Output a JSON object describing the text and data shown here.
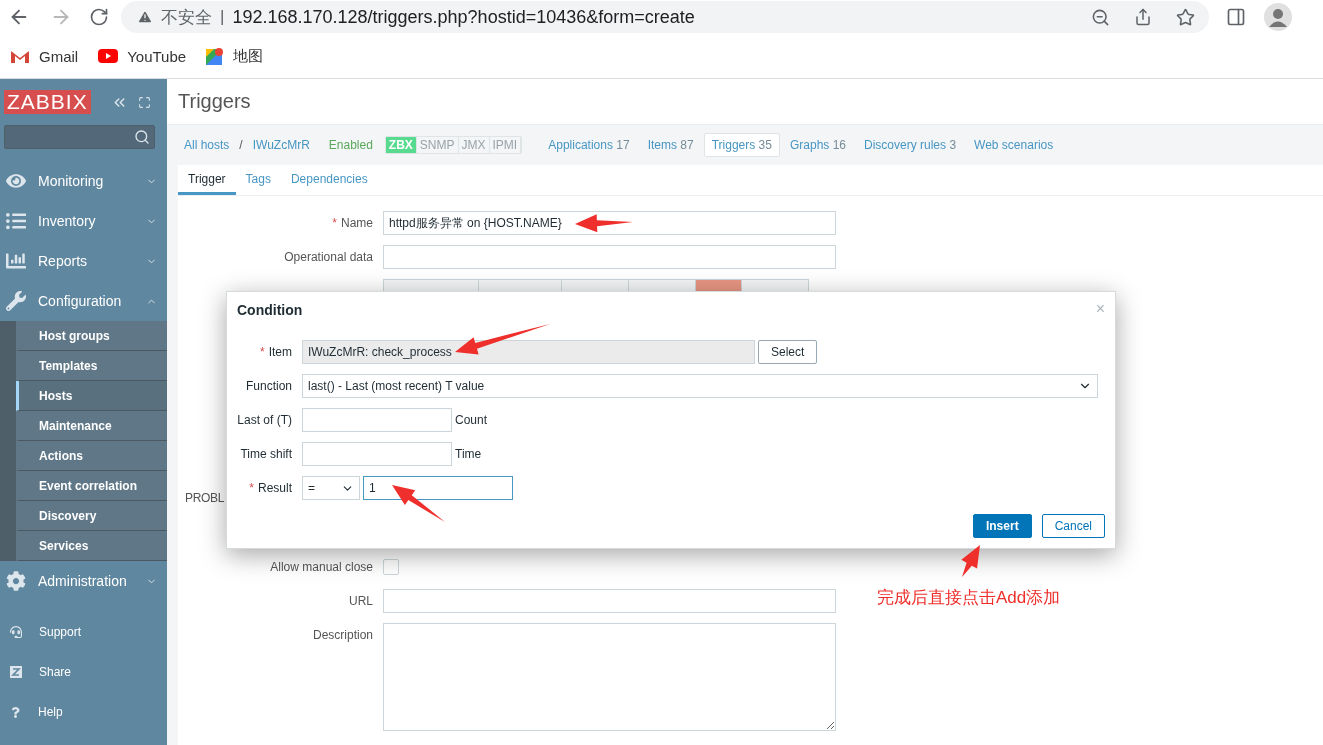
{
  "browser": {
    "security": "不安全",
    "separator": "|",
    "url": "192.168.170.128/triggers.php?hostid=10436&form=create",
    "bookmarks": [
      {
        "label": "Gmail"
      },
      {
        "label": "YouTube"
      },
      {
        "label": "地图"
      }
    ]
  },
  "sidebar": {
    "logo": "ZABBIX",
    "menu": [
      {
        "label": "Monitoring",
        "expanded": false
      },
      {
        "label": "Inventory",
        "expanded": false
      },
      {
        "label": "Reports",
        "expanded": false
      },
      {
        "label": "Configuration",
        "expanded": true,
        "children": [
          {
            "label": "Host groups",
            "selected": false
          },
          {
            "label": "Templates",
            "selected": false
          },
          {
            "label": "Hosts",
            "selected": true
          },
          {
            "label": "Maintenance",
            "selected": false
          },
          {
            "label": "Actions",
            "selected": false
          },
          {
            "label": "Event correlation",
            "selected": false
          },
          {
            "label": "Discovery",
            "selected": false
          },
          {
            "label": "Services",
            "selected": false
          }
        ]
      },
      {
        "label": "Administration",
        "expanded": false
      }
    ],
    "links": [
      {
        "label": "Support"
      },
      {
        "label": "Share"
      },
      {
        "label": "Help"
      }
    ]
  },
  "header": {
    "title": "Triggers"
  },
  "host_nav": {
    "breadcrumbs": [
      "All hosts",
      "IWuZcMrR"
    ],
    "separator": "/",
    "status": "Enabled",
    "availability": [
      {
        "label": "ZBX",
        "on": true
      },
      {
        "label": "SNMP",
        "on": false
      },
      {
        "label": "JMX",
        "on": false
      },
      {
        "label": "IPMI",
        "on": false
      }
    ],
    "tabs": [
      {
        "label": "Applications",
        "count": "17",
        "selected": false
      },
      {
        "label": "Items",
        "count": "87",
        "selected": false
      },
      {
        "label": "Triggers",
        "count": "35",
        "selected": true
      },
      {
        "label": "Graphs",
        "count": "16",
        "selected": false
      },
      {
        "label": "Discovery rules",
        "count": "3",
        "selected": false
      },
      {
        "label": "Web scenarios",
        "selected": false
      }
    ]
  },
  "form_tabs": [
    {
      "label": "Trigger",
      "selected": true
    },
    {
      "label": "Tags",
      "selected": false
    },
    {
      "label": "Dependencies",
      "selected": false
    }
  ],
  "form": {
    "name": {
      "label": "Name",
      "required": true,
      "value": "httpd服务异常 on {HOST.NAME}"
    },
    "operational_data": {
      "label": "Operational data"
    },
    "severity": {
      "options": [
        {
          "selected": false
        },
        {
          "selected": false
        },
        {
          "selected": false
        },
        {
          "selected": false
        },
        {
          "selected": true
        },
        {
          "selected": false
        }
      ]
    },
    "problem_mode_label": "PROBL",
    "allow_manual_close": {
      "label": "Allow manual close",
      "checked": false
    },
    "url": {
      "label": "URL"
    },
    "description": {
      "label": "Description"
    }
  },
  "condition_dialog": {
    "title": "Condition",
    "close": "×",
    "item": {
      "label": "Item",
      "required": true,
      "value": "IWuZcMrR: check_process",
      "readonly": true,
      "button": "Select"
    },
    "function": {
      "label": "Function",
      "value": "last() - Last (most recent) T value"
    },
    "last_of": {
      "label": "Last of (T)",
      "suffix": "Count"
    },
    "time_shift": {
      "label": "Time shift",
      "suffix": "Time"
    },
    "result": {
      "label": "Result",
      "required": true,
      "operator": "=",
      "value": "1",
      "focused": true
    },
    "buttons": [
      {
        "label": "Insert",
        "kind": "primary"
      },
      {
        "label": "Cancel",
        "kind": "secondary"
      }
    ]
  },
  "annotation": {
    "text": "完成后直接点击Add添加"
  },
  "required_mark": "*"
}
